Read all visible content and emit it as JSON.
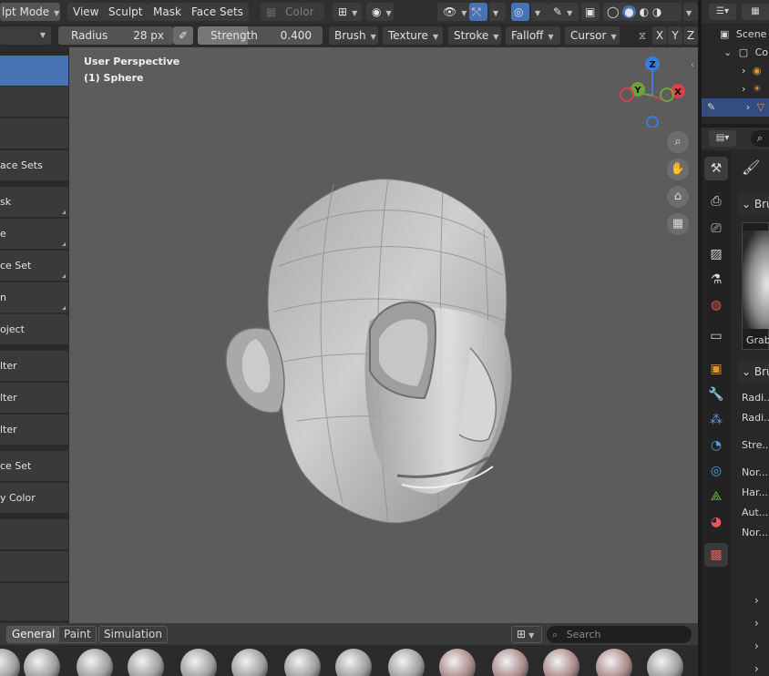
{
  "header": {
    "mode_label": "lpt Mode",
    "menus": [
      "View",
      "Sculpt",
      "Mask",
      "Face Sets"
    ],
    "color_label": "Color"
  },
  "tool_settings": {
    "radius_label": "Radius",
    "radius_value": "28 px",
    "strength_label": "Strength",
    "strength_value": "0.400",
    "menus": [
      "Brush",
      "Texture",
      "Stroke",
      "Falloff",
      "Cursor"
    ],
    "axes": [
      "X",
      "Y",
      "Z"
    ]
  },
  "left_toolbar": {
    "items": [
      "",
      "",
      "",
      "ace Sets",
      "sk",
      "e",
      "ce Set",
      "n",
      "oject",
      "lter",
      "lter",
      "lter",
      "ce Set",
      "y Color",
      "",
      "",
      ""
    ]
  },
  "viewport": {
    "perspective": "User Perspective",
    "object": "(1) Sphere",
    "gizmo": {
      "z": "Z",
      "y": "Y",
      "x": "X"
    }
  },
  "bottom": {
    "tabs": [
      "General",
      "Paint",
      "Simulation"
    ],
    "search_placeholder": "Search"
  },
  "outliner": {
    "scene_label": "Scene",
    "collection_label": "Co"
  },
  "properties": {
    "brush_panel": "Bru",
    "brush_name": "Grab",
    "settings_panel": "Bru",
    "rows": [
      "Radi...",
      "Radi...",
      "Stre...",
      "Nor...",
      "Har...",
      "Aut...",
      "Nor..."
    ]
  },
  "colors": {
    "accent": "#4772b3",
    "viewport_bg": "#5c5c5c",
    "gizmo_x": "#d9414a",
    "gizmo_y": "#6fa23a",
    "gizmo_z": "#3b7bd9"
  }
}
